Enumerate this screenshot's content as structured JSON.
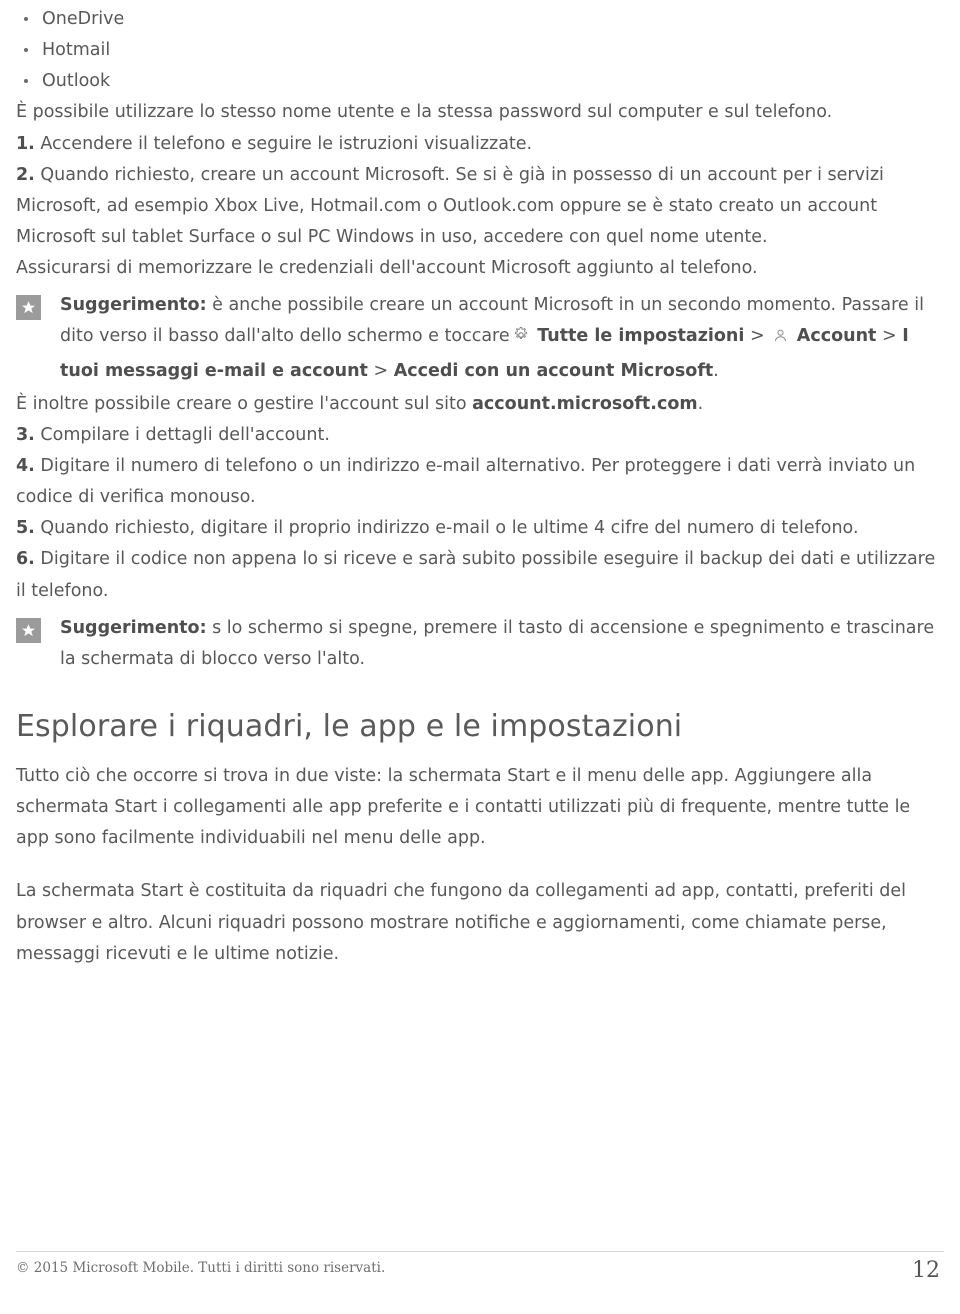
{
  "document": {
    "bullets": [
      "OneDrive",
      "Hotmail",
      "Outlook"
    ],
    "intro": "È possibile utilizzare lo stesso nome utente e la stessa password sul computer e sul telefono.",
    "steps_first": [
      {
        "num": "1.",
        "text": " Accendere il telefono e seguire le istruzioni visualizzate."
      },
      {
        "num": "2.",
        "text": " Quando richiesto, creare un account Microsoft. Se si è già in possesso di un account per i servizi Microsoft, ad esempio Xbox Live, Hotmail.com o Outlook.com oppure se è stato creato un account Microsoft sul tablet Surface o sul PC Windows in uso, accedere con quel nome utente."
      }
    ],
    "note_credentials": "Assicurarsi di memorizzare le credenziali dell'account Microsoft aggiunto al telefono.",
    "tip1": {
      "icon": "star-tip-icon",
      "label": "Suggerimento:",
      "text_part1": " è anche possibile creare un account Microsoft in un secondo momento. Passare il dito verso il basso dall'alto dello schermo e toccare",
      "gear_icon": "gear-icon",
      "bold_all_settings": "Tutte le impostazioni",
      "sep1": ">",
      "person_icon": "person-icon",
      "bold_account": "Account",
      "sep2": ">",
      "bold_email_accounts": "I tuoi messaggi e-mail e account",
      "sep3": ">",
      "bold_sign_in": "Accedi con un account Microsoft",
      "period": "."
    },
    "manage_line": {
      "text": "È inoltre possibile creare o gestire l'account sul sito ",
      "bold": "account.microsoft.com",
      "period": "."
    },
    "steps_rest": [
      {
        "num": "3.",
        "text": " Compilare i dettagli dell'account."
      },
      {
        "num": "4.",
        "text": " Digitare il numero di telefono o un indirizzo e-mail alternativo. Per proteggere i dati verrà inviato un codice di verifica monouso."
      },
      {
        "num": "5.",
        "text": " Quando richiesto, digitare il proprio indirizzo e-mail o le ultime 4 cifre del numero di telefono."
      },
      {
        "num": "6.",
        "text": " Digitare il codice non appena lo si riceve e sarà subito possibile eseguire il backup dei dati e utilizzare il telefono."
      }
    ],
    "tip2": {
      "icon": "star-tip-icon",
      "label": "Suggerimento:",
      "text": " s lo schermo si spegne, premere il tasto di accensione e spegnimento e trascinare la schermata di blocco verso l'alto."
    },
    "section_title": "Esplorare i riquadri, le app e le impostazioni",
    "body_paragraphs": [
      "Tutto ciò che occorre si trova in due viste: la schermata Start e il menu delle app. Aggiungere alla schermata Start i collegamenti alle app preferite e i contatti utilizzati più di frequente, mentre tutte le app sono facilmente individuabili nel menu delle app.",
      "La schermata Start è costituita da riquadri che fungono da collegamenti ad app, contatti, preferiti del browser e altro. Alcuni riquadri possono mostrare notifiche e aggiornamenti, come chiamate perse, messaggi ricevuti e le ultime notizie."
    ]
  },
  "footer": {
    "copyright": "© 2015 Microsoft Mobile. Tutti i diritti sono riservati.",
    "page_number": "12"
  },
  "colors": {
    "text": "#585858",
    "heading": "#5a5a5a",
    "tip_icon_bg": "#9b9b9b",
    "rule": "#d9d9d9"
  }
}
